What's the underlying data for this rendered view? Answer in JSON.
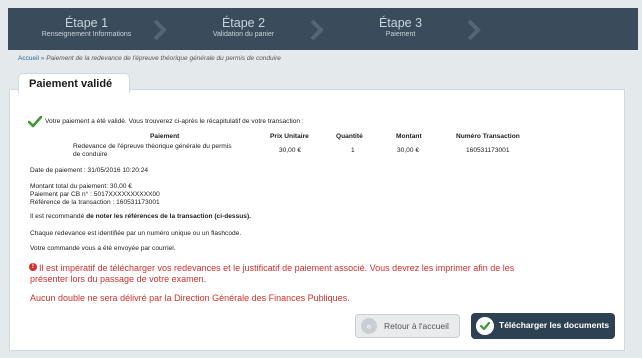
{
  "steps": [
    {
      "label": "Étape 1",
      "sub": "Renseignement Informations"
    },
    {
      "label": "Étape 2",
      "sub": "Validation du panier"
    },
    {
      "label": "Étape 3",
      "sub": "Paiement"
    }
  ],
  "breadcrumb": {
    "home": "Accueil",
    "separator": " » ",
    "current": "Paiement de la redevance de l'épreuve théorique générale du permis de conduire"
  },
  "panel": {
    "tab_title": "Paiement validé"
  },
  "confirmation": "Votre paiement a été validé. Vous trouverez ci-après le récapitulatif de votre transaction :",
  "table": {
    "headers": {
      "payment": "Paiement",
      "unit_price": "Prix Unitaire",
      "quantity": "Quantité",
      "amount": "Montant",
      "transaction": "Numéro Transaction"
    },
    "row": {
      "payment_line1": "Redevance de l'épreuve théorique générale du permis",
      "payment_line2": "de conduire",
      "unit_price": "30,00 €",
      "quantity": "1",
      "amount": "30,00 €",
      "transaction": "160531173001"
    }
  },
  "details": {
    "date": "Date de paiement : 31/05/2016 10:20:24",
    "total": "Montant total du paiement: 30,00 €",
    "card": "Paiement par CB n° : 5017XXXXXXXXXX00",
    "reference": "Référence de la transaction : 160531173001"
  },
  "notes": {
    "recommend_prefix": "Il est recommandé ",
    "recommend_bold": "de noter les références de la transaction (ci-dessus).",
    "unique": "Chaque redevance est identifiée par un numéro unique ou un flashcode.",
    "email": "Votre commande vous a été envoyée par courriel."
  },
  "warning": {
    "icon": "!",
    "line1": "Il est impératif de télécharger vos redevances et le justificatif de paiement associé. Vous devrez les imprimer afin de les",
    "line2": "présenter lors du passage de votre examen.",
    "line3": "Aucun double ne sera délivré par la Direction Générale des Finances Publiques."
  },
  "buttons": {
    "back_icon": "«",
    "back": "Retour à l'accueil",
    "download": "Télécharger les documents"
  },
  "colors": {
    "step_bar": "#3a4b5c",
    "warning": "#d0312d",
    "check": "#3c9a2e",
    "primary_button": "#2e4153"
  }
}
